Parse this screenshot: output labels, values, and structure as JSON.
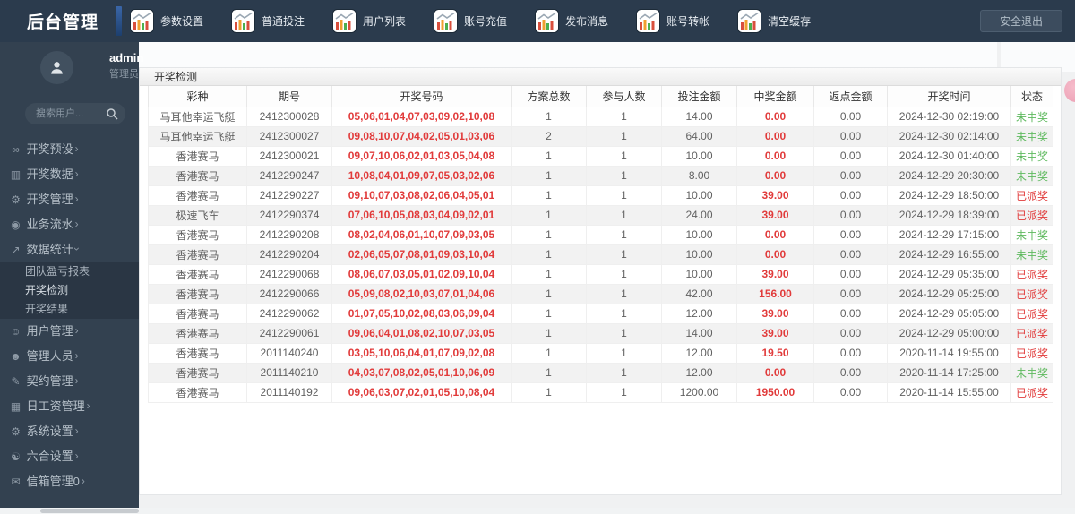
{
  "app": {
    "title": "后台管理",
    "logout_label": "安全退出"
  },
  "topnav": {
    "items": [
      {
        "label": "参数设置"
      },
      {
        "label": "普通投注"
      },
      {
        "label": "用户列表"
      },
      {
        "label": "账号充值"
      },
      {
        "label": "发布消息"
      },
      {
        "label": "账号转帐"
      },
      {
        "label": "清空缓存"
      }
    ]
  },
  "user": {
    "name": "admin",
    "role": "管理员"
  },
  "search": {
    "placeholder": "搜索用户..."
  },
  "sidebar": {
    "items": [
      {
        "icon": "link-icon",
        "glyph": "∞",
        "label": "开奖预设"
      },
      {
        "icon": "bar-chart-icon",
        "glyph": "▥",
        "label": "开奖数据"
      },
      {
        "icon": "gears-icon",
        "glyph": "⚙",
        "label": "开奖管理"
      },
      {
        "icon": "camera-icon",
        "glyph": "◉",
        "label": "业务流水"
      },
      {
        "icon": "line-chart-icon",
        "glyph": "↗",
        "label": "数据统计",
        "expanded": true,
        "children": [
          "团队盈亏报表",
          "开奖检测",
          "开奖结果"
        ],
        "active_child": "开奖检测"
      },
      {
        "icon": "users-icon",
        "glyph": "☺",
        "label": "用户管理"
      },
      {
        "icon": "user-plus-icon",
        "glyph": "☻",
        "label": "管理人员"
      },
      {
        "icon": "file-icon",
        "glyph": "✎",
        "label": "契约管理"
      },
      {
        "icon": "calendar-icon",
        "glyph": "▦",
        "label": "日工资管理"
      },
      {
        "icon": "gear-icon",
        "glyph": "⚙",
        "label": "系统设置"
      },
      {
        "icon": "comments-icon",
        "glyph": "☯",
        "label": "六合设置"
      },
      {
        "icon": "envelope-icon",
        "glyph": "✉",
        "label": "信箱管理0"
      }
    ]
  },
  "panel": {
    "title": "开奖检测"
  },
  "table": {
    "columns": [
      "彩种",
      "期号",
      "开奖号码",
      "方案总数",
      "参与人数",
      "投注金额",
      "中奖金额",
      "返点金额",
      "开奖时间",
      "状态"
    ],
    "rows": [
      {
        "lottery": "马耳他幸运飞艇",
        "issue": "2412300028",
        "numbers": "05,06,01,04,07,03,09,02,10,08",
        "plans": "1",
        "players": "1",
        "bet": "14.00",
        "win": "0.00",
        "rebate": "0.00",
        "time": "2024-12-30 02:19:00",
        "status": "未中奖",
        "status_type": "none"
      },
      {
        "lottery": "马耳他幸运飞艇",
        "issue": "2412300027",
        "numbers": "09,08,10,07,04,02,05,01,03,06",
        "plans": "2",
        "players": "1",
        "bet": "64.00",
        "win": "0.00",
        "rebate": "0.00",
        "time": "2024-12-30 02:14:00",
        "status": "未中奖",
        "status_type": "none"
      },
      {
        "lottery": "香港赛马",
        "issue": "2412300021",
        "numbers": "09,07,10,06,02,01,03,05,04,08",
        "plans": "1",
        "players": "1",
        "bet": "10.00",
        "win": "0.00",
        "rebate": "0.00",
        "time": "2024-12-30 01:40:00",
        "status": "未中奖",
        "status_type": "none"
      },
      {
        "lottery": "香港赛马",
        "issue": "2412290247",
        "numbers": "10,08,04,01,09,07,05,03,02,06",
        "plans": "1",
        "players": "1",
        "bet": "8.00",
        "win": "0.00",
        "rebate": "0.00",
        "time": "2024-12-29 20:30:00",
        "status": "未中奖",
        "status_type": "none"
      },
      {
        "lottery": "香港赛马",
        "issue": "2412290227",
        "numbers": "09,10,07,03,08,02,06,04,05,01",
        "plans": "1",
        "players": "1",
        "bet": "10.00",
        "win": "39.00",
        "rebate": "0.00",
        "time": "2024-12-29 18:50:00",
        "status": "已派奖",
        "status_type": "paid"
      },
      {
        "lottery": "极速飞车",
        "issue": "2412290374",
        "numbers": "07,06,10,05,08,03,04,09,02,01",
        "plans": "1",
        "players": "1",
        "bet": "24.00",
        "win": "39.00",
        "rebate": "0.00",
        "time": "2024-12-29 18:39:00",
        "status": "已派奖",
        "status_type": "paid"
      },
      {
        "lottery": "香港赛马",
        "issue": "2412290208",
        "numbers": "08,02,04,06,01,10,07,09,03,05",
        "plans": "1",
        "players": "1",
        "bet": "10.00",
        "win": "0.00",
        "rebate": "0.00",
        "time": "2024-12-29 17:15:00",
        "status": "未中奖",
        "status_type": "none"
      },
      {
        "lottery": "香港赛马",
        "issue": "2412290204",
        "numbers": "02,06,05,07,08,01,09,03,10,04",
        "plans": "1",
        "players": "1",
        "bet": "10.00",
        "win": "0.00",
        "rebate": "0.00",
        "time": "2024-12-29 16:55:00",
        "status": "未中奖",
        "status_type": "none"
      },
      {
        "lottery": "香港赛马",
        "issue": "2412290068",
        "numbers": "08,06,07,03,05,01,02,09,10,04",
        "plans": "1",
        "players": "1",
        "bet": "10.00",
        "win": "39.00",
        "rebate": "0.00",
        "time": "2024-12-29 05:35:00",
        "status": "已派奖",
        "status_type": "paid"
      },
      {
        "lottery": "香港赛马",
        "issue": "2412290066",
        "numbers": "05,09,08,02,10,03,07,01,04,06",
        "plans": "1",
        "players": "1",
        "bet": "42.00",
        "win": "156.00",
        "rebate": "0.00",
        "time": "2024-12-29 05:25:00",
        "status": "已派奖",
        "status_type": "paid"
      },
      {
        "lottery": "香港赛马",
        "issue": "2412290062",
        "numbers": "01,07,05,10,02,08,03,06,09,04",
        "plans": "1",
        "players": "1",
        "bet": "12.00",
        "win": "39.00",
        "rebate": "0.00",
        "time": "2024-12-29 05:05:00",
        "status": "已派奖",
        "status_type": "paid"
      },
      {
        "lottery": "香港赛马",
        "issue": "2412290061",
        "numbers": "09,06,04,01,08,02,10,07,03,05",
        "plans": "1",
        "players": "1",
        "bet": "14.00",
        "win": "39.00",
        "rebate": "0.00",
        "time": "2024-12-29 05:00:00",
        "status": "已派奖",
        "status_type": "paid"
      },
      {
        "lottery": "香港赛马",
        "issue": "2011140240",
        "numbers": "03,05,10,06,04,01,07,09,02,08",
        "plans": "1",
        "players": "1",
        "bet": "12.00",
        "win": "19.50",
        "rebate": "0.00",
        "time": "2020-11-14 19:55:00",
        "status": "已派奖",
        "status_type": "paid"
      },
      {
        "lottery": "香港赛马",
        "issue": "2011140210",
        "numbers": "04,03,07,08,02,05,01,10,06,09",
        "plans": "1",
        "players": "1",
        "bet": "12.00",
        "win": "0.00",
        "rebate": "0.00",
        "time": "2020-11-14 17:25:00",
        "status": "未中奖",
        "status_type": "none"
      },
      {
        "lottery": "香港赛马",
        "issue": "2011140192",
        "numbers": "09,06,03,07,02,01,05,10,08,04",
        "plans": "1",
        "players": "1",
        "bet": "1200.00",
        "win": "1950.00",
        "rebate": "0.00",
        "time": "2020-11-14 15:55:00",
        "status": "已派奖",
        "status_type": "paid"
      }
    ]
  },
  "colors": {
    "red": "#e13b3b",
    "green": "#5eb95e",
    "accent": "#3a66a8"
  }
}
